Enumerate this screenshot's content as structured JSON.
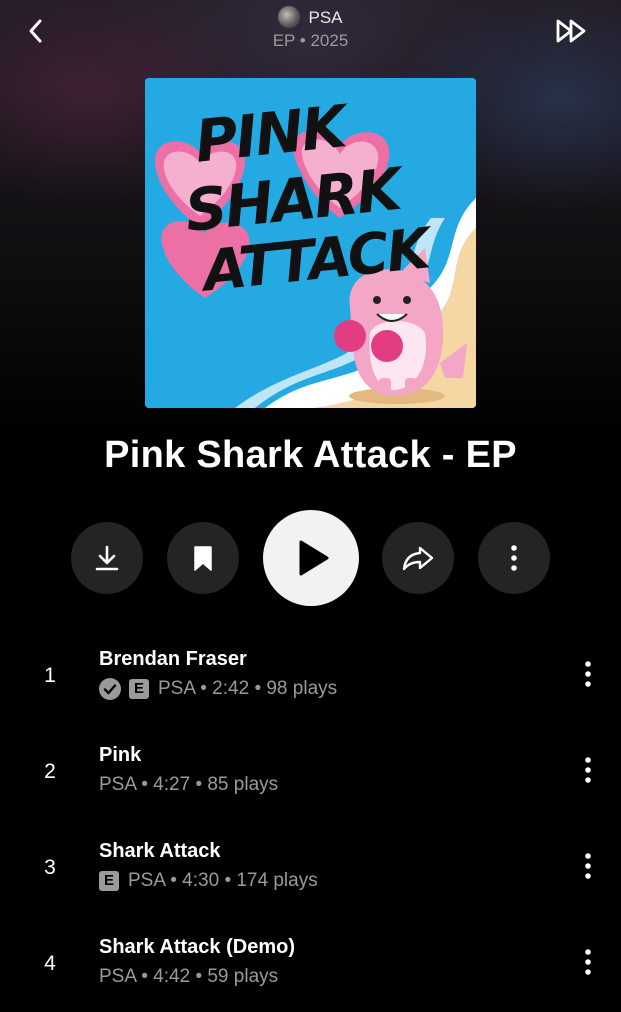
{
  "header": {
    "artist": "PSA",
    "meta": "EP • 2025"
  },
  "artwork": {
    "text_lines": [
      "PINK",
      "SHARK",
      "ATTACK"
    ],
    "colors": {
      "sky": "#25a9e3",
      "pink": "#ec6fa6",
      "sand": "#f4d7a3"
    }
  },
  "album": {
    "title": "Pink Shark Attack - EP"
  },
  "actions": {
    "download": "download-icon",
    "save": "bookmark-icon",
    "play": "play-icon",
    "share": "share-icon",
    "more": "more-vertical-icon"
  },
  "tracks": [
    {
      "number": "1",
      "title": "Brendan Fraser",
      "verified": true,
      "explicit": true,
      "meta": "PSA • 2:42 • 98 plays"
    },
    {
      "number": "2",
      "title": "Pink",
      "verified": false,
      "explicit": false,
      "meta": "PSA • 4:27 • 85 plays"
    },
    {
      "number": "3",
      "title": "Shark Attack",
      "verified": false,
      "explicit": true,
      "meta": "PSA • 4:30 • 174 plays"
    },
    {
      "number": "4",
      "title": "Shark Attack (Demo)",
      "verified": false,
      "explicit": false,
      "meta": "PSA • 4:42 • 59 plays"
    }
  ],
  "labels": {
    "explicit_badge": "E"
  }
}
